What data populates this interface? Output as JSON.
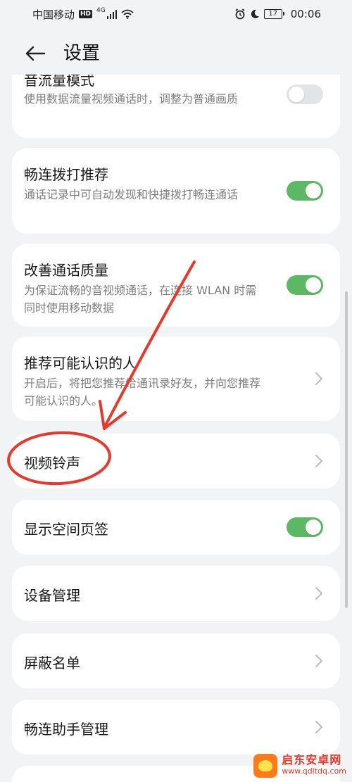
{
  "status_bar": {
    "carrier": "中国移动",
    "hd": "HD",
    "network": "4G",
    "battery": "17",
    "time": "00:06"
  },
  "header": {
    "title": "设置"
  },
  "settings": {
    "data_mode_title": "音流量模式",
    "data_mode_desc": "使用数据流量视频通话时，调整为普通画质",
    "changlian_title": "畅连拨打推荐",
    "changlian_desc": "通话记录中可自动发现和快捷拨打畅连通话",
    "quality_title": "改善通话质量",
    "quality_desc": "为保证流畅的音视频通话，在连接 WLAN 时需同时使用移动数据",
    "recommend_title": "推荐可能认识的人",
    "recommend_desc": "开启后，将把您推荐给通讯录好友，并向您推荐可能认识的人。",
    "ringtone_title": "视频铃声",
    "space_tab_title": "显示空间页签",
    "device_title": "设备管理",
    "block_title": "屏蔽名单",
    "assistant_title": "畅连助手管理"
  },
  "toggles": {
    "data_mode": false,
    "changlian": true,
    "quality": true,
    "space_tab": true
  },
  "colors": {
    "toggle_on": "#5cb865",
    "toggle_off": "#e3e4e6",
    "annotation_red": "#e23a2f",
    "background": "#f1f3f5"
  },
  "watermark": {
    "name": "启东安卓网",
    "url": "www.qdltdq.com"
  }
}
